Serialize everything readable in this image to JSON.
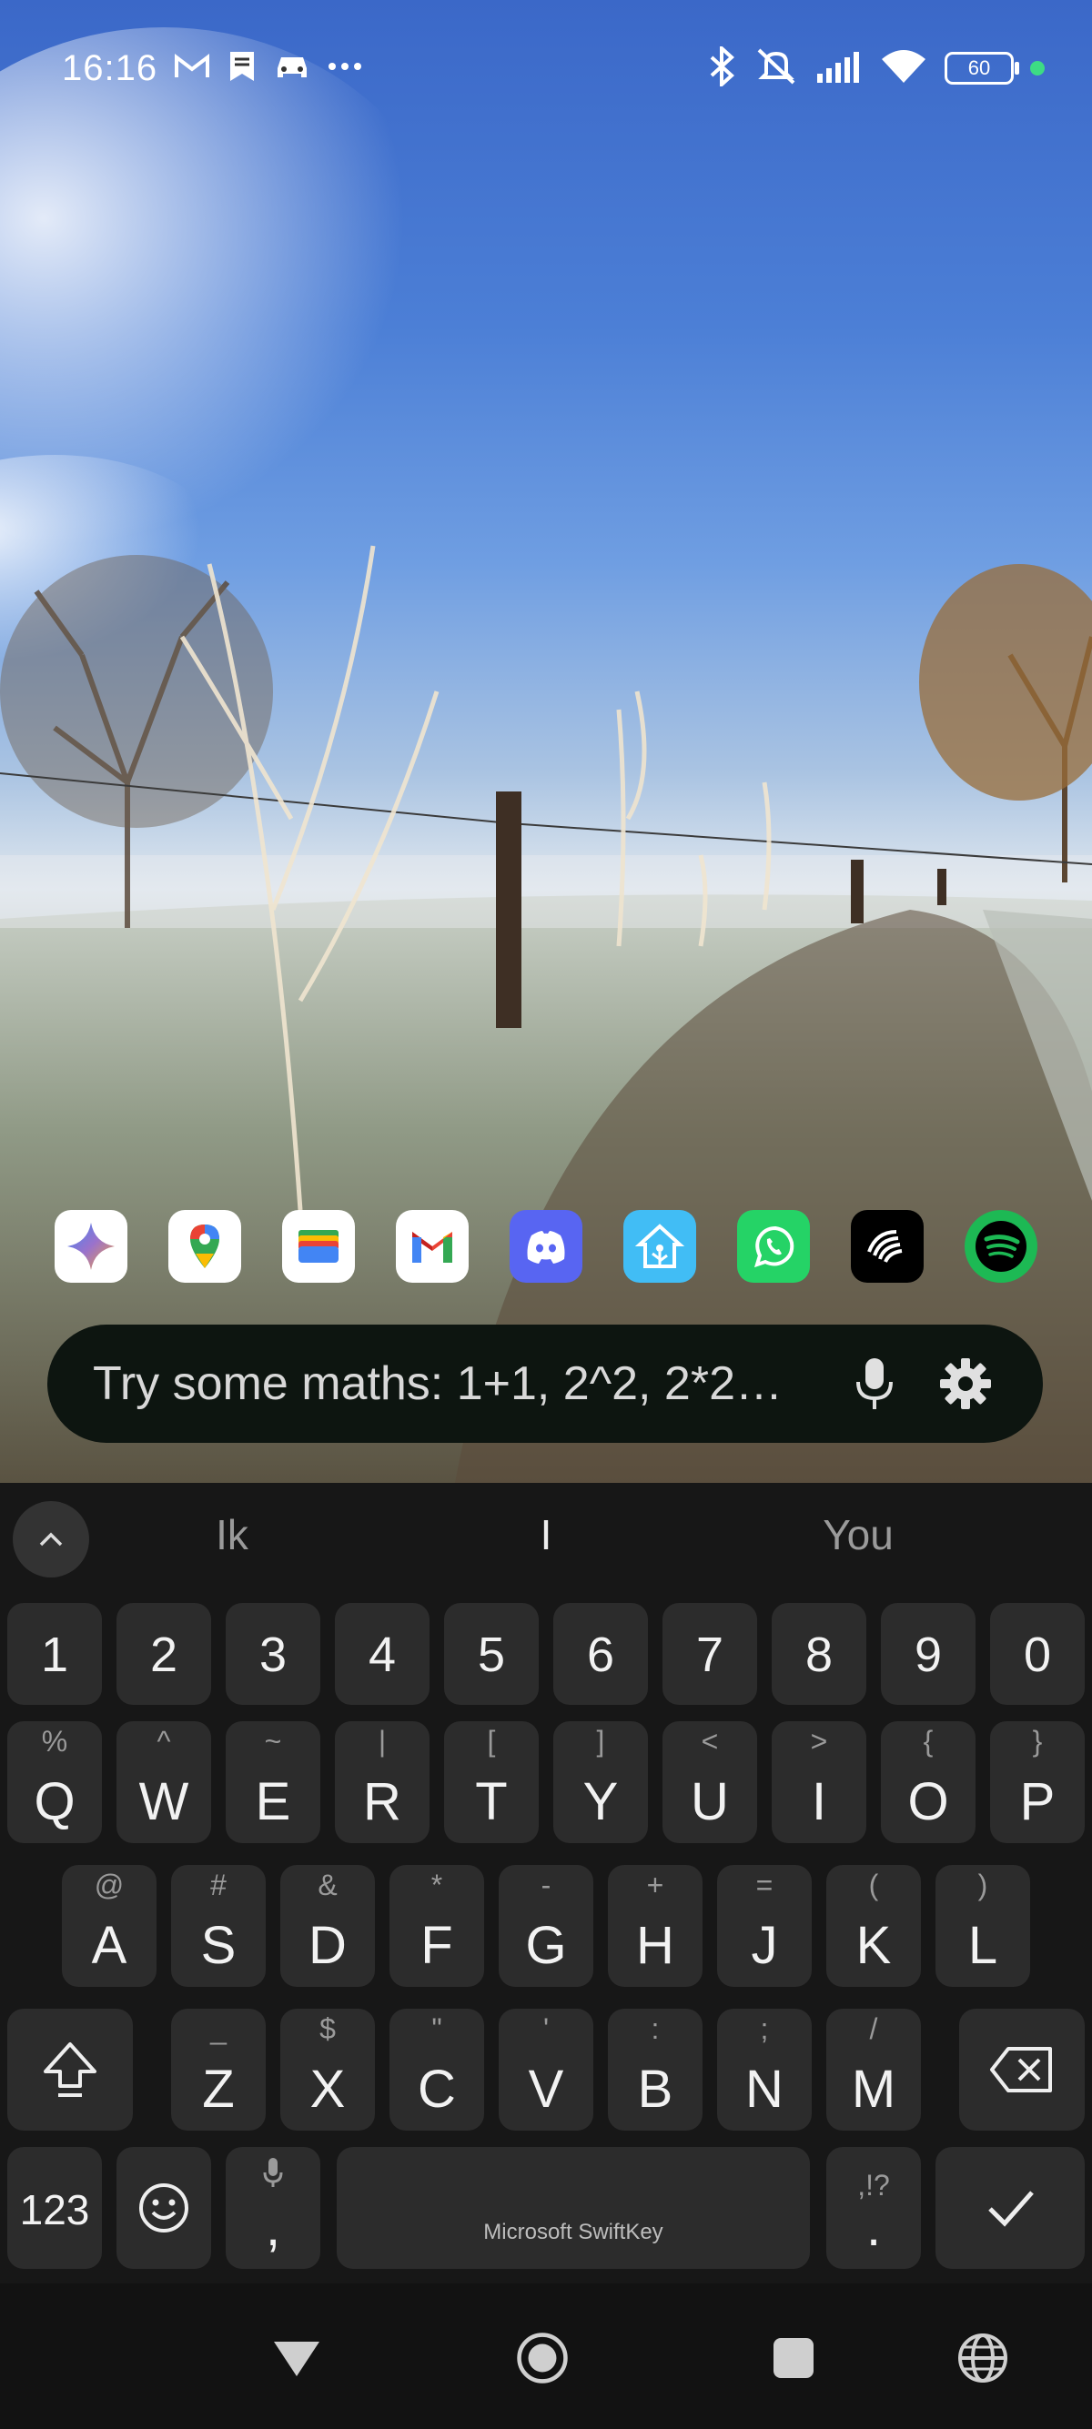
{
  "status_bar": {
    "time": "16:16",
    "battery": "60",
    "notification_icons": [
      "gmail-icon",
      "bookmark-icon",
      "car-icon",
      "more-dots-icon"
    ],
    "system_icons": [
      "bluetooth-icon",
      "mute-icon",
      "signal-icon",
      "wifi-icon",
      "battery-icon",
      "privacy-dot-icon"
    ]
  },
  "dock": {
    "apps": [
      {
        "name": "gemini-app-icon"
      },
      {
        "name": "google-maps-app-icon"
      },
      {
        "name": "google-wallet-app-icon"
      },
      {
        "name": "gmail-app-icon"
      },
      {
        "name": "discord-app-icon"
      },
      {
        "name": "home-assistant-app-icon"
      },
      {
        "name": "whatsapp-app-icon"
      },
      {
        "name": "wear-app-icon"
      },
      {
        "name": "spotify-app-icon"
      }
    ]
  },
  "search": {
    "placeholder": "Try some maths: 1+1, 2^2, 2*2…"
  },
  "keyboard": {
    "suggestions": [
      "Ik",
      "I",
      "You"
    ],
    "number_row": [
      "1",
      "2",
      "3",
      "4",
      "5",
      "6",
      "7",
      "8",
      "9",
      "0"
    ],
    "row1": [
      {
        "main": "Q",
        "alt": "%"
      },
      {
        "main": "W",
        "alt": "^"
      },
      {
        "main": "E",
        "alt": "~"
      },
      {
        "main": "R",
        "alt": "|"
      },
      {
        "main": "T",
        "alt": "["
      },
      {
        "main": "Y",
        "alt": "]"
      },
      {
        "main": "U",
        "alt": "<"
      },
      {
        "main": "I",
        "alt": ">"
      },
      {
        "main": "O",
        "alt": "{"
      },
      {
        "main": "P",
        "alt": "}"
      }
    ],
    "row2": [
      {
        "main": "A",
        "alt": "@"
      },
      {
        "main": "S",
        "alt": "#"
      },
      {
        "main": "D",
        "alt": "&"
      },
      {
        "main": "F",
        "alt": "*"
      },
      {
        "main": "G",
        "alt": "-"
      },
      {
        "main": "H",
        "alt": "+"
      },
      {
        "main": "J",
        "alt": "="
      },
      {
        "main": "K",
        "alt": "("
      },
      {
        "main": "L",
        "alt": ")"
      }
    ],
    "row3": [
      {
        "main": "Z",
        "alt": "_"
      },
      {
        "main": "X",
        "alt": "$"
      },
      {
        "main": "C",
        "alt": "\""
      },
      {
        "main": "V",
        "alt": "'"
      },
      {
        "main": "B",
        "alt": ":"
      },
      {
        "main": "N",
        "alt": ";"
      },
      {
        "main": "M",
        "alt": "/"
      }
    ],
    "symbols_key": "123",
    "comma_key": ",",
    "period_key": ".",
    "period_alt": ",!?",
    "space_label": "Microsoft SwiftKey"
  },
  "colors": {
    "keyboard_bg": "#171717",
    "key_bg": "#2c2c2c",
    "searchbar_bg": "#0d1510",
    "privacy_dot": "#3ddc84"
  }
}
